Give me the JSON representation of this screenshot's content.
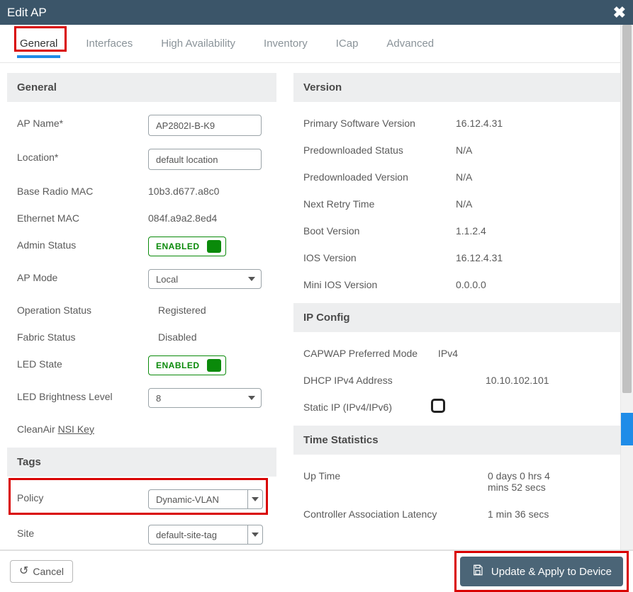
{
  "title": "Edit AP",
  "tabs": [
    "General",
    "Interfaces",
    "High Availability",
    "Inventory",
    "ICap",
    "Advanced"
  ],
  "sections": {
    "general": "General",
    "tags": "Tags",
    "version": "Version",
    "ip": "IP Config",
    "time": "Time Statistics"
  },
  "general": {
    "ap_name_label": "AP Name*",
    "ap_name": "AP2802I-B-K9",
    "location_label": "Location*",
    "location": "default location",
    "base_mac_label": "Base Radio MAC",
    "base_mac": "10b3.d677.a8c0",
    "eth_mac_label": "Ethernet MAC",
    "eth_mac": "084f.a9a2.8ed4",
    "admin_label": "Admin Status",
    "admin_status": "ENABLED",
    "mode_label": "AP Mode",
    "mode": "Local",
    "op_label": "Operation Status",
    "op_status": "Registered",
    "fabric_label": "Fabric Status",
    "fabric_status": "Disabled",
    "led_label": "LED State",
    "led_state": "ENABLED",
    "bright_label": "LED Brightness Level",
    "bright": "8",
    "cleanair_prefix": "CleanAir ",
    "cleanair_link": "NSI Key"
  },
  "tags": {
    "policy_label": "Policy",
    "policy": "Dynamic-VLAN",
    "site_label": "Site",
    "site": "default-site-tag"
  },
  "version": {
    "primary_label": "Primary Software Version",
    "primary": "16.12.4.31",
    "predl_status_label": "Predownloaded Status",
    "predl_status": "N/A",
    "predl_ver_label": "Predownloaded Version",
    "predl_ver": "N/A",
    "retry_label": "Next Retry Time",
    "retry": "N/A",
    "boot_label": "Boot Version",
    "boot": "1.1.2.4",
    "ios_label": "IOS Version",
    "ios": "16.12.4.31",
    "mini_label": "Mini IOS Version",
    "mini": "0.0.0.0"
  },
  "ip": {
    "capwap_label": "CAPWAP Preferred Mode",
    "capwap": "IPv4",
    "dhcp_label": "DHCP IPv4 Address",
    "dhcp": "10.10.102.101",
    "static_label": "Static IP (IPv4/IPv6)"
  },
  "time": {
    "up_label": "Up Time",
    "up": "0 days 0 hrs 4 mins 52 secs",
    "lat_label": "Controller Association Latency",
    "lat": "1 min 36 secs"
  },
  "footer": {
    "cancel": "Cancel",
    "apply": "Update & Apply to Device"
  }
}
